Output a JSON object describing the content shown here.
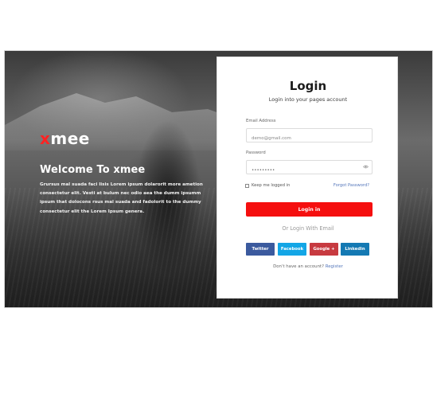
{
  "brand": {
    "x": "x",
    "rest": "mee"
  },
  "hero": {
    "welcome": "Welcome To xmee",
    "description": "Grursus mal suada faci lisis Lorem ipsum dolarorit more ametion consectetur elit. Vesti at bulum nec odio aea the dumm ipsumm ipsum that dolocons rsus mal suada and fadolorit to the dummy consectetur elit the Lorem Ipsum genera."
  },
  "login": {
    "title": "Login",
    "subtitle": "Login into your pages account",
    "email_label": "Email Address",
    "email_placeholder": "demo@gmail.com",
    "password_label": "Password",
    "password_value": "•••••••••",
    "remember_label": "Keep me logged in",
    "forgot_label": "Forgot Password?",
    "button_label": "Login in",
    "or_text": "Or Login With Email",
    "social": {
      "twitter": "Twitter",
      "facebook": "Facebook",
      "google": "Google +",
      "linkedin": "Linkedin"
    },
    "register_prefix": "Don't have an account? ",
    "register_link": "Register"
  },
  "colors": {
    "primary_red": "#f50f0f",
    "twitter": "#3b5a9e",
    "facebook": "#13a6e6",
    "google": "#c73a40",
    "linkedin": "#1479b3",
    "link_blue": "#5577bb"
  }
}
